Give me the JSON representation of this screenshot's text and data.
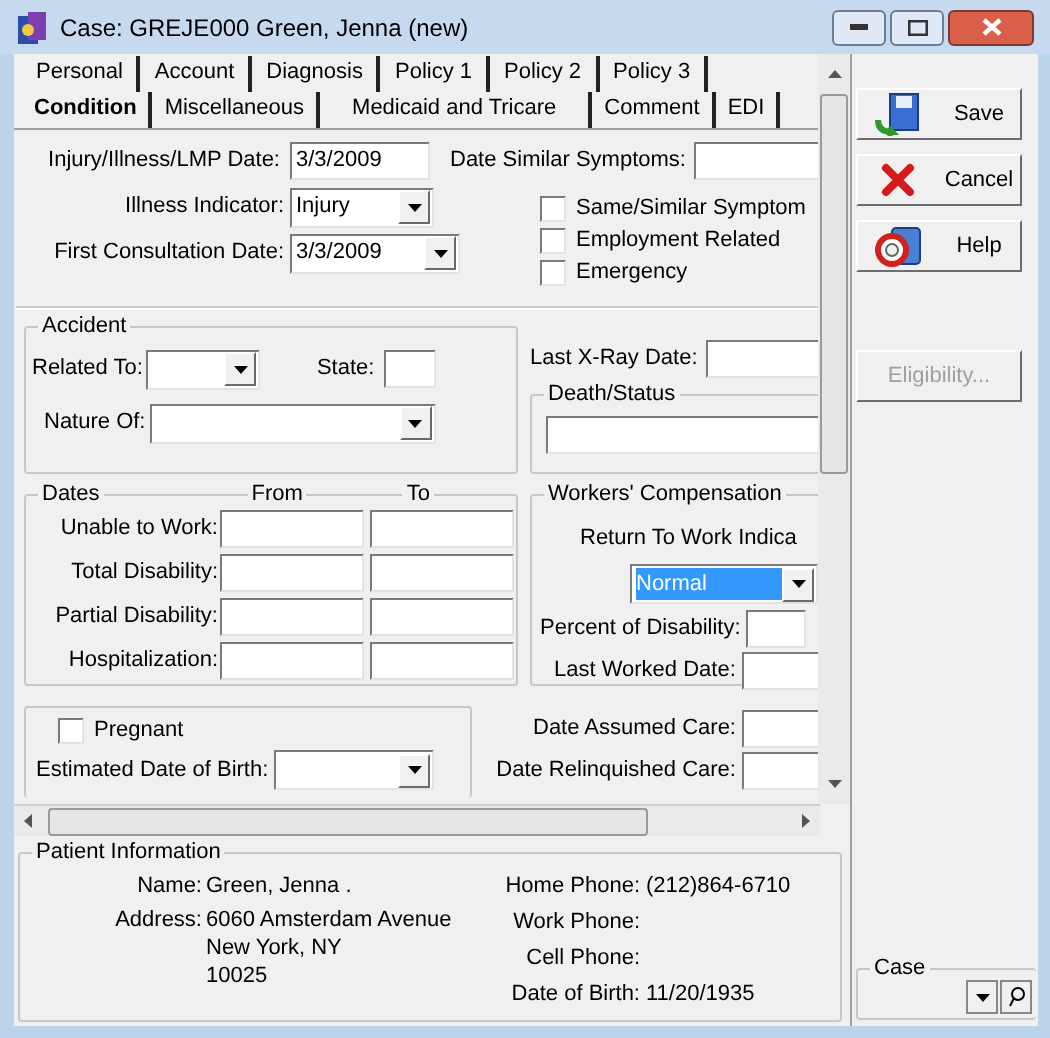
{
  "window": {
    "title": "Case: GREJE000 Green, Jenna  (new)"
  },
  "tab_rows": [
    [
      {
        "label": "Personal",
        "selected": false
      },
      {
        "label": "Account",
        "selected": false
      },
      {
        "label": "Diagnosis",
        "selected": false
      },
      {
        "label": "Policy 1",
        "selected": false
      },
      {
        "label": "Policy 2",
        "selected": false
      },
      {
        "label": "Policy 3",
        "selected": false
      }
    ],
    [
      {
        "label": "Condition",
        "selected": true
      },
      {
        "label": "Miscellaneous",
        "selected": false
      },
      {
        "label": "Medicaid and Tricare",
        "selected": false
      },
      {
        "label": "Comment",
        "selected": false
      },
      {
        "label": "EDI",
        "selected": false
      }
    ]
  ],
  "top_fields": [
    {
      "label": "Injury/Illness/LMP Date:",
      "value": "3/3/2009",
      "kind": "text"
    },
    {
      "label": "Illness Indicator:",
      "value": "Injury",
      "kind": "combo"
    },
    {
      "label": "First Consultation Date:",
      "value": "3/3/2009",
      "kind": "combo"
    }
  ],
  "similar_date": {
    "label": "Date Similar Symptoms:"
  },
  "checkboxes": [
    {
      "label": "Same/Similar Symptom",
      "checked": false
    },
    {
      "label": "Employment Related",
      "checked": false
    },
    {
      "label": "Emergency",
      "checked": false
    }
  ],
  "accident": {
    "title": "Accident",
    "related_to": "Related To:",
    "state": "State:",
    "nature_of": "Nature Of:"
  },
  "last_xray": {
    "label": "Last X-Ray Date:"
  },
  "death_status": {
    "title": "Death/Status"
  },
  "dates": {
    "title": "Dates",
    "from": "From",
    "to": "To",
    "rows": [
      {
        "label": "Unable to Work:"
      },
      {
        "label": "Total Disability:"
      },
      {
        "label": "Partial Disability:"
      },
      {
        "label": "Hospitalization:"
      }
    ]
  },
  "workers_comp": {
    "title": "Workers' Compensation",
    "return_label": "Return To Work Indica",
    "return_value": "Normal",
    "return_selected": true,
    "percent_label": "Percent of Disability:",
    "last_worked_label": "Last Worked Date:"
  },
  "pregnancy": {
    "label": "Pregnant",
    "checked": false,
    "edb_label": "Estimated Date of Birth:"
  },
  "care": [
    {
      "label": "Date Assumed Care:"
    },
    {
      "label": "Date Relinquished Care:"
    }
  ],
  "buttons": [
    {
      "label": "Save",
      "kind": "save",
      "disabled": false
    },
    {
      "label": "Cancel",
      "kind": "cancel",
      "disabled": false
    },
    {
      "label": "Help",
      "kind": "help",
      "disabled": false
    },
    {
      "label": "Eligibility...",
      "kind": "plain",
      "disabled": true
    }
  ],
  "patient_info": {
    "title": "Patient Information",
    "left": [
      {
        "label": "Name:",
        "lines": [
          "Green, Jenna ."
        ]
      },
      {
        "label": "Address:",
        "lines": [
          "6060 Amsterdam Avenue",
          "New York, NY",
          "10025"
        ]
      }
    ],
    "right": [
      {
        "label": "Home Phone:",
        "value": "(212)864-6710"
      },
      {
        "label": "Work Phone:"
      },
      {
        "label": "Cell Phone:"
      },
      {
        "label": "Date of Birth:",
        "value": "11/20/1935"
      }
    ]
  },
  "case": {
    "title": "Case"
  }
}
